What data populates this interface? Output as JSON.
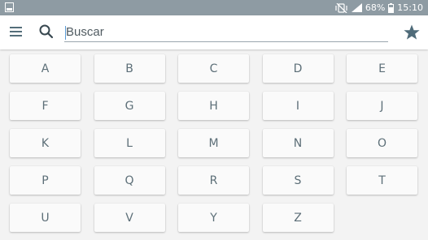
{
  "status_bar": {
    "battery_percent": "68%",
    "time": "15:10",
    "icons": [
      "screenshot-icon",
      "mute-vibrate-icon",
      "signal-icon",
      "battery-icon"
    ]
  },
  "toolbar": {
    "menu_icon": "hamburger-menu-icon",
    "search_icon": "search-icon",
    "search_placeholder": "Buscar",
    "search_value": "",
    "favorite_icon": "star-icon"
  },
  "letters": [
    "A",
    "B",
    "C",
    "D",
    "E",
    "F",
    "G",
    "H",
    "I",
    "J",
    "K",
    "L",
    "M",
    "N",
    "O",
    "P",
    "Q",
    "R",
    "S",
    "T",
    "U",
    "V",
    "Y",
    "Z"
  ],
  "colors": {
    "status_bar": "#8e9ba3",
    "toolbar_icons": "#546e7a",
    "letter_text": "#5d6f78",
    "button_bg": "#fafafa",
    "page_bg": "#f3f3f3"
  }
}
